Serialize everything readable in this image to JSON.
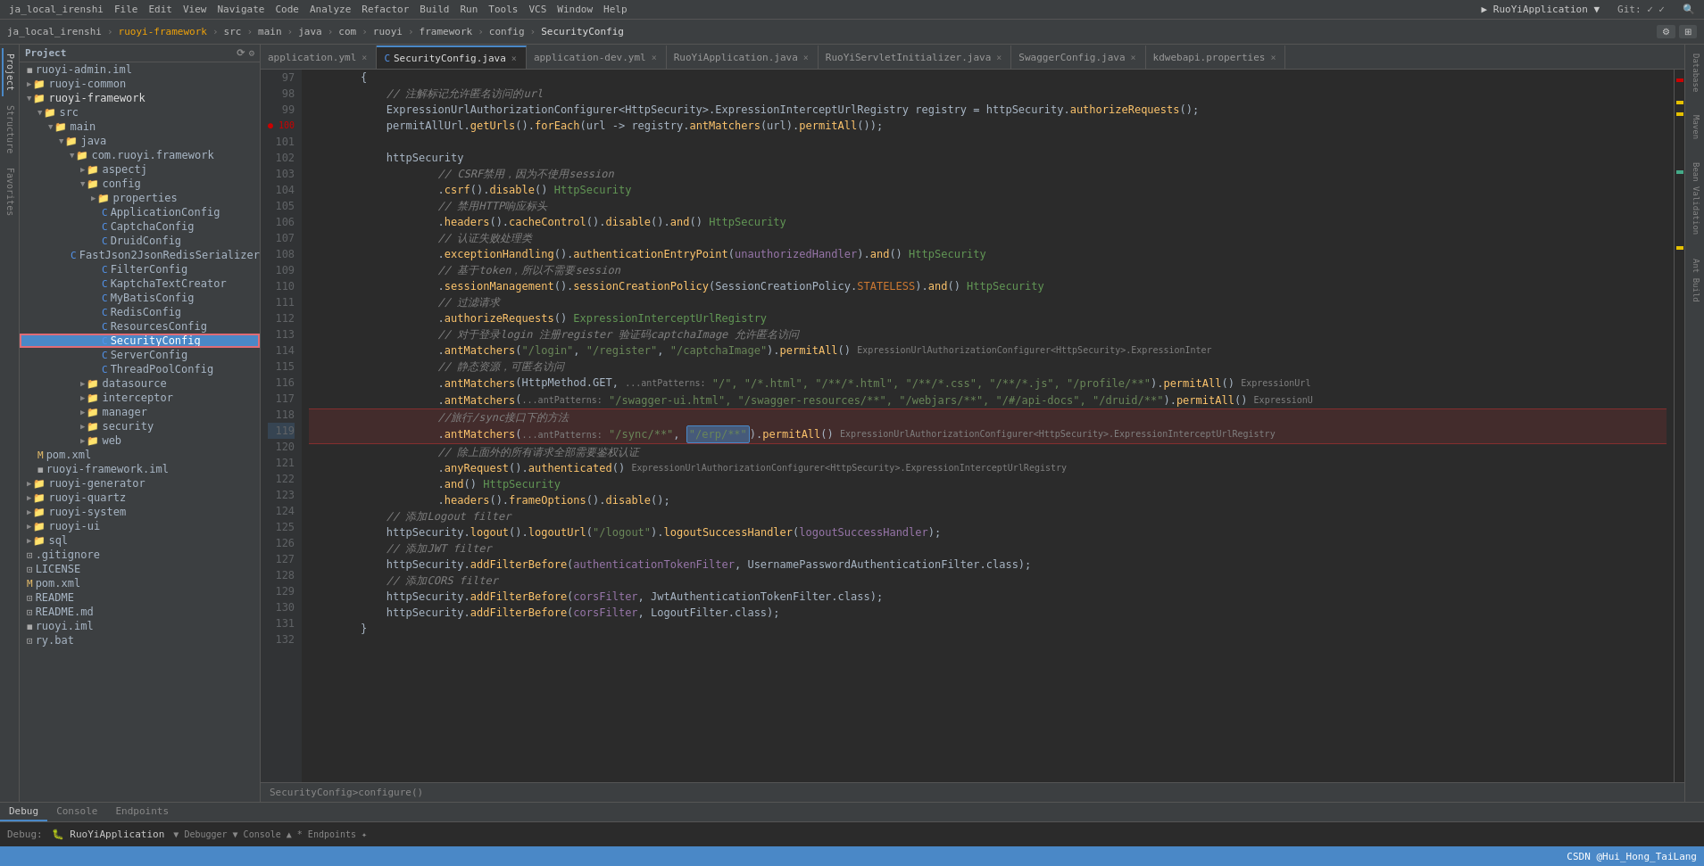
{
  "menuBar": {
    "items": [
      "ja_local_irenshi",
      "File",
      "Edit",
      "View",
      "Navigate",
      "Code",
      "Analyze",
      "Refactor",
      "Build",
      "Run",
      "Tools",
      "VCS",
      "Window",
      "Help"
    ]
  },
  "titleBar": {
    "breadcrumb": [
      "ja_local_irenshi",
      "ruoyi-framework",
      "src",
      "main",
      "java",
      "com",
      "ruoyi",
      "framework",
      "config",
      "SecurityConfig"
    ],
    "appName": "RuoYiApplication",
    "gitLabel": "Git:"
  },
  "tabs": [
    {
      "label": "application.yml",
      "active": false,
      "modified": false
    },
    {
      "label": "SecurityConfig.java",
      "active": true,
      "modified": false
    },
    {
      "label": "application-dev.yml",
      "active": false,
      "modified": false
    },
    {
      "label": "RuoYiApplication.java",
      "active": false,
      "modified": false
    },
    {
      "label": "RuoYiServletInitializer.java",
      "active": false,
      "modified": false
    },
    {
      "label": "SwaggerConfig.java",
      "active": false,
      "modified": false
    },
    {
      "label": "kdwebapi.properties",
      "active": false,
      "modified": false
    }
  ],
  "sidebar": {
    "title": "Project",
    "tree": [
      {
        "indent": 0,
        "type": "file",
        "icon": "iml",
        "label": "ruoyi-admin.iml"
      },
      {
        "indent": 0,
        "type": "folder",
        "label": "ruoyi-common",
        "open": false
      },
      {
        "indent": 0,
        "type": "folder",
        "label": "ruoyi-framework",
        "open": true
      },
      {
        "indent": 1,
        "type": "folder",
        "label": "src",
        "open": true
      },
      {
        "indent": 2,
        "type": "folder",
        "label": "main",
        "open": true
      },
      {
        "indent": 3,
        "type": "folder",
        "label": "java",
        "open": true
      },
      {
        "indent": 4,
        "type": "folder",
        "label": "com.ruoyi.framework",
        "open": true
      },
      {
        "indent": 5,
        "type": "folder",
        "label": "aspectj",
        "open": false
      },
      {
        "indent": 5,
        "type": "folder",
        "label": "config",
        "open": true
      },
      {
        "indent": 6,
        "type": "folder",
        "label": "properties",
        "open": false
      },
      {
        "indent": 6,
        "type": "file",
        "icon": "java",
        "label": "ApplicationConfig"
      },
      {
        "indent": 6,
        "type": "file",
        "icon": "java",
        "label": "CaptchaConfig"
      },
      {
        "indent": 6,
        "type": "file",
        "icon": "java",
        "label": "DruidConfig"
      },
      {
        "indent": 6,
        "type": "file",
        "icon": "java",
        "label": "FastJson2JsonRedisSerializer"
      },
      {
        "indent": 6,
        "type": "file",
        "icon": "java",
        "label": "FilterConfig"
      },
      {
        "indent": 6,
        "type": "file",
        "icon": "java",
        "label": "KaptchaTextCreator"
      },
      {
        "indent": 6,
        "type": "file",
        "icon": "java",
        "label": "MyBatisConfig"
      },
      {
        "indent": 6,
        "type": "file",
        "icon": "java",
        "label": "RedisConfig"
      },
      {
        "indent": 6,
        "type": "file",
        "icon": "java",
        "label": "ResourcesConfig"
      },
      {
        "indent": 6,
        "type": "file",
        "icon": "java",
        "label": "SecurityConfig",
        "selected": true
      },
      {
        "indent": 6,
        "type": "file",
        "icon": "java",
        "label": "ServerConfig"
      },
      {
        "indent": 6,
        "type": "file",
        "icon": "java",
        "label": "ThreadPoolConfig"
      },
      {
        "indent": 5,
        "type": "folder",
        "label": "datasource",
        "open": false
      },
      {
        "indent": 5,
        "type": "folder",
        "label": "interceptor",
        "open": false
      },
      {
        "indent": 5,
        "type": "folder",
        "label": "manager",
        "open": false
      },
      {
        "indent": 5,
        "type": "folder",
        "label": "security",
        "open": false
      },
      {
        "indent": 5,
        "type": "folder",
        "label": "web",
        "open": false
      },
      {
        "indent": 1,
        "type": "file",
        "icon": "xml",
        "label": "pom.xml"
      },
      {
        "indent": 1,
        "type": "file",
        "icon": "iml",
        "label": "ruoyi-framework.iml"
      },
      {
        "indent": 0,
        "type": "folder",
        "label": "ruoyi-generator",
        "open": false
      },
      {
        "indent": 0,
        "type": "folder",
        "label": "ruoyi-quartz",
        "open": false
      },
      {
        "indent": 0,
        "type": "folder",
        "label": "ruoyi-system",
        "open": false
      },
      {
        "indent": 0,
        "type": "folder",
        "label": "ruoyi-ui",
        "open": false
      },
      {
        "indent": 0,
        "type": "folder",
        "label": "sql",
        "open": false
      },
      {
        "indent": 0,
        "type": "file",
        "icon": "gitignore",
        "label": ".gitignore"
      },
      {
        "indent": 0,
        "type": "file",
        "icon": "license",
        "label": "LICENSE"
      },
      {
        "indent": 0,
        "type": "file",
        "icon": "xml",
        "label": "pom.xml"
      },
      {
        "indent": 0,
        "type": "file",
        "icon": "txt",
        "label": "README"
      },
      {
        "indent": 0,
        "type": "file",
        "icon": "md",
        "label": "README.md"
      },
      {
        "indent": 0,
        "type": "file",
        "icon": "iml",
        "label": "ruoyi.iml"
      },
      {
        "indent": 0,
        "type": "file",
        "icon": "bat",
        "label": "ry.bat"
      }
    ]
  },
  "code": {
    "lines": [
      {
        "num": 97,
        "content": "        {"
      },
      {
        "num": 98,
        "content": "            // 注解标记允许匿名访问的url"
      },
      {
        "num": 99,
        "content": "            ExpressionUrlAuthorizationConfigurer<HttpSecurity>.ExpressionInterceptUrlRegistry registry = httpSecurity.authorizeRequests();"
      },
      {
        "num": 100,
        "content": "            permitAllUrl.getUrls().forEach(url -> registry.antMatchers(url).permitAll());"
      },
      {
        "num": 101,
        "content": ""
      },
      {
        "num": 102,
        "content": "            httpSecurity"
      },
      {
        "num": 103,
        "content": "                    // CSRF禁用，因为不使用session"
      },
      {
        "num": 104,
        "content": "                    .csrf().disable() HttpSecurity"
      },
      {
        "num": 105,
        "content": "                    // 禁用HTTP响应标头"
      },
      {
        "num": 106,
        "content": "                    .headers().cacheControl().disable().and() HttpSecurity"
      },
      {
        "num": 107,
        "content": "                    // 认证失败处理类"
      },
      {
        "num": 108,
        "content": "                    .exceptionHandling().authenticationEntryPoint(unauthorizedHandler).and() HttpSecurity"
      },
      {
        "num": 109,
        "content": "                    // 基于token，所以不需要session"
      },
      {
        "num": 110,
        "content": "                    .sessionManagement().sessionCreationPolicy(SessionCreationPolicy.STATELESS).and() HttpSecurity"
      },
      {
        "num": 111,
        "content": "                    // 过滤请求"
      },
      {
        "num": 112,
        "content": "                    .authorizeRequests() ExpressionInterceptUrlRegistry"
      },
      {
        "num": 113,
        "content": "                    // 对于登录login 注册register 验证码captchaImage 允许匿名访问"
      },
      {
        "num": 114,
        "content": "                    .antMatchers(\"/login\", \"/register\", \"/captchaImage\").permitAll() ExpressionUrlAuthorizationConfigurer<HttpSecurity>.ExpressionInter"
      },
      {
        "num": 115,
        "content": "                    // 静态资源，可匿名访问"
      },
      {
        "num": 116,
        "content": "                    .antMatchers(HttpMethod.GET, ...antPatterns: \"/\", \"/*.html\", \"/**/*.html\", \"/**/*.css\", \"/**/*.js\", \"/profile/**\").permitAll() ExpressionUrl"
      },
      {
        "num": 117,
        "content": "                    .antMatchers(...antPatterns: \"/swagger-ui.html\", \"/swagger-resources/**\", \"/webjars/**\", \"/#/api-docs\", \"/druid/**\").permitAll() ExpressionU"
      },
      {
        "num": 118,
        "content": "                    //旅行/sync接口下的方法"
      },
      {
        "num": 119,
        "content": "                    .antMatchers(...antPatterns: \"/sync/**\", \"/erp/**\").permitAll() ExpressionUrlAuthorizationConfigurer<HttpSecurity>.ExpressionInterceptUrlRegistry",
        "highlighted": true
      },
      {
        "num": 120,
        "content": "                    // 除上面外的所有请求全部需要鉴权认证"
      },
      {
        "num": 121,
        "content": "                    .anyRequest().authenticated() ExpressionUrlAuthorizationConfigurer<HttpSecurity>.ExpressionInterceptUrlRegistry"
      },
      {
        "num": 122,
        "content": "                    .and() HttpSecurity"
      },
      {
        "num": 123,
        "content": "                    .headers().frameOptions().disable();"
      },
      {
        "num": 124,
        "content": "            // 添加Logout filter"
      },
      {
        "num": 125,
        "content": "            httpSecurity.logout().logoutUrl(\"/logout\").logoutSuccessHandler(logoutSuccessHandler);"
      },
      {
        "num": 126,
        "content": "            // 添加JWT filter"
      },
      {
        "num": 127,
        "content": "            httpSecurity.addFilterBefore(authenticationTokenFilter, UsernamePasswordAuthenticationFilter.class);"
      },
      {
        "num": 128,
        "content": "            // 添加CORS filter"
      },
      {
        "num": 129,
        "content": "            httpSecurity.addFilterBefore(corsFilter, JwtAuthenticationTokenFilter.class);"
      },
      {
        "num": 130,
        "content": "            httpSecurity.addFilterBefore(corsFilter, LogoutFilter.class);"
      },
      {
        "num": 131,
        "content": "        }"
      },
      {
        "num": 132,
        "content": ""
      }
    ]
  },
  "bottomTabs": [
    "Debug",
    "Console",
    "Endpoints"
  ],
  "debugInfo": {
    "label": "Debug:",
    "app": "RuoYiApplication"
  },
  "footerBreadcrumb": "SecurityConfig > configure()",
  "statusBar": {
    "text": "CSDN @Hui_Hong_TaiLang"
  },
  "vtabsLeft": [
    "Structure",
    "Favorites"
  ],
  "vtabsRight": [
    "Database",
    "Maven",
    "Bean Validation",
    "Ant Build"
  ]
}
